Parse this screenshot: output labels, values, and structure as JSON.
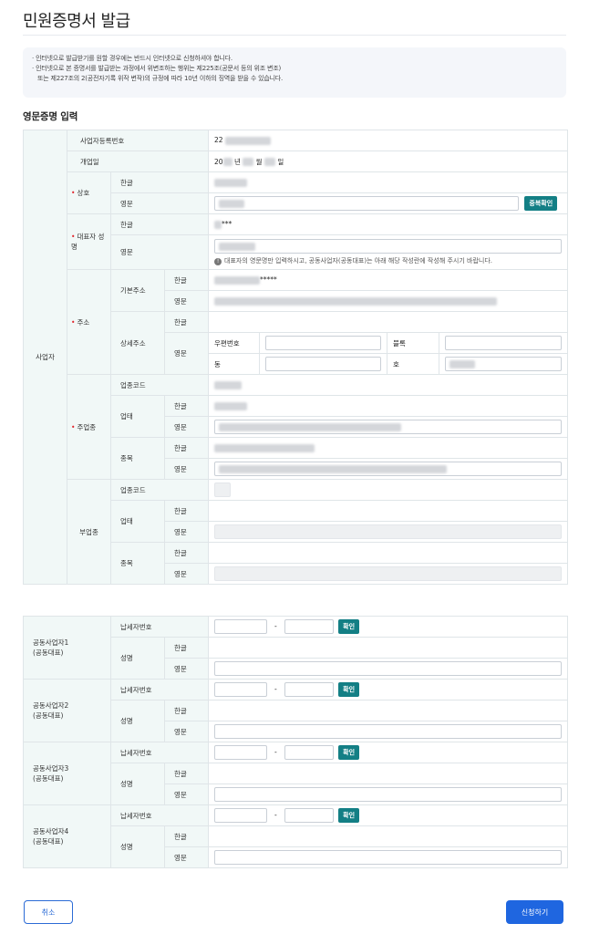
{
  "page": {
    "title": "민원증명서 발급",
    "notice": [
      "인터넷으로 발급받기를 원할 경우에는 반드시 인터넷으로 신청하셔야 합니다.",
      "인터넷으로 본 증명서를 발급받는 과정에서 위변조하는 행위는 제225조(공문서 등의 위조 변조)",
      "또는 제227조의 2(공전자기록 위작 변작)의 규정에 따라 10년 이하의 징역을 받을 수 있습니다."
    ],
    "section_title": "영문증명 입력"
  },
  "business": {
    "group_label": "사업자",
    "reg_no_label": "사업자등록번호",
    "reg_no_value": "22",
    "open_date_label": "개업일",
    "open_date_year_prefix": "20",
    "open_date_year_unit": "년",
    "open_date_month_unit": "월",
    "open_date_day_unit": "일",
    "trade_name_label": "상호",
    "korean_label": "한글",
    "english_label": "영문",
    "dup_check_button": "중복확인",
    "rep_name_label": "대표자 성명",
    "rep_name_korean_suffix": "***",
    "rep_hint": "대표자의 영문명만 입력하시고, 공동사업자(공동대표)는 아래 해당 작성란에 작성해 주시기 바랍니다.",
    "address_label": "주소",
    "basic_address_label": "기본주소",
    "basic_address_suffix": "*****",
    "detail_address_label": "상세주소",
    "postal_label": "우편번호",
    "block_label": "블록",
    "dong_label": "동",
    "ho_label": "호",
    "main_industry_label": "주업종",
    "industry_code_label": "업종코드",
    "business_type_label": "업태",
    "item_label": "종목",
    "sub_industry_label": "부업종"
  },
  "co_owners": [
    {
      "label": "공동사업자1",
      "sub": "(공동대표)"
    },
    {
      "label": "공동사업자2",
      "sub": "(공동대표)"
    },
    {
      "label": "공동사업자3",
      "sub": "(공동대표)"
    },
    {
      "label": "공동사업자4",
      "sub": "(공동대표)"
    }
  ],
  "co_owner_fields": {
    "tax_id_label": "납세자번호",
    "dash": "-",
    "confirm_button": "확인",
    "name_label": "성명",
    "korean_label": "한글",
    "english_label": "영문"
  },
  "actions": {
    "cancel": "취소",
    "submit": "신청하기"
  }
}
